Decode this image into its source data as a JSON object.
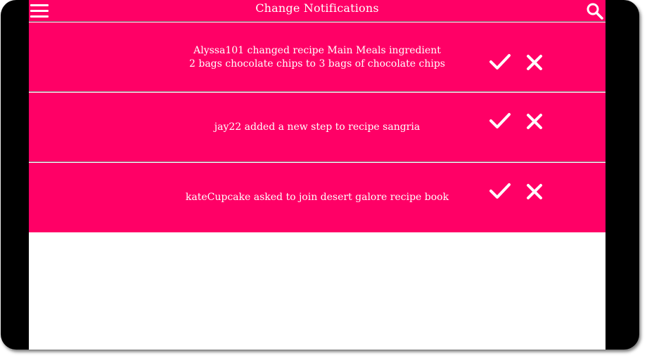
{
  "appbar": {
    "title": "Change Notifications",
    "menu_icon": "hamburger-menu-icon",
    "search_icon": "search-icon",
    "color": "#ff0066"
  },
  "notifications": [
    {
      "line1": "Alyssa101 changed recipe Main Meals ingredient",
      "line2": "2 bags chocolate chips to 3 bags of chocolate chips",
      "accept_icon": "checkmark-icon",
      "reject_icon": "close-icon"
    },
    {
      "line1": "jay22 added a new step to recipe sangria",
      "line2": "",
      "accept_icon": "checkmark-icon",
      "reject_icon": "close-icon"
    },
    {
      "line1": "kateCupcake asked to join desert galore recipe book",
      "line2": "",
      "accept_icon": "checkmark-icon",
      "reject_icon": "close-icon"
    }
  ],
  "colors": {
    "accent": "#ff0066",
    "text": "#ffffff",
    "frame": "#000000"
  }
}
